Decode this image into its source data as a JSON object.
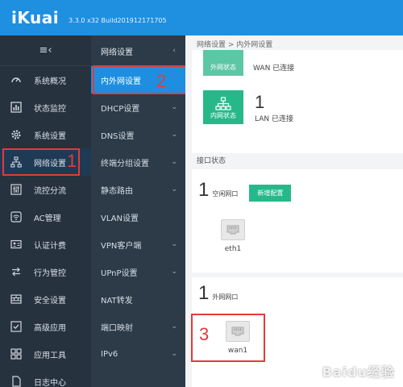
{
  "header": {
    "logo": "iKuai",
    "version": "3.3.0 x32 Build201912171705"
  },
  "sidebar": {
    "collapse_icon": "≡‹",
    "items": [
      {
        "label": "系统概况",
        "icon": "gauge-icon"
      },
      {
        "label": "状态监控",
        "icon": "chart-icon"
      },
      {
        "label": "系统设置",
        "icon": "gear-icon"
      },
      {
        "label": "网络设置",
        "icon": "network-icon",
        "active": true
      },
      {
        "label": "流控分流",
        "icon": "sliders-icon"
      },
      {
        "label": "AC管理",
        "icon": "wifi-icon"
      },
      {
        "label": "认证计费",
        "icon": "id-card-icon"
      },
      {
        "label": "行为管控",
        "icon": "arrows-icon"
      },
      {
        "label": "安全设置",
        "icon": "shield-icon"
      },
      {
        "label": "高级应用",
        "icon": "check-icon"
      },
      {
        "label": "应用工具",
        "icon": "grid-icon"
      },
      {
        "label": "日志中心",
        "icon": "doc-icon"
      }
    ]
  },
  "submenu": {
    "title": "网络设置",
    "items": [
      {
        "label": "内外网设置",
        "active": true,
        "chevron": false
      },
      {
        "label": "DHCP设置",
        "chevron": true
      },
      {
        "label": "DNS设置",
        "chevron": true
      },
      {
        "label": "终端分组设置",
        "chevron": true
      },
      {
        "label": "静态路由",
        "chevron": true
      },
      {
        "label": "VLAN设置",
        "chevron": false
      },
      {
        "label": "VPN客户端",
        "chevron": true
      },
      {
        "label": "UPnP设置",
        "chevron": true
      },
      {
        "label": "NAT转发",
        "chevron": false
      },
      {
        "label": "端口映射",
        "chevron": true
      },
      {
        "label": "IPv6",
        "chevron": true
      }
    ]
  },
  "main": {
    "breadcrumb": "网络设置 > 内外网设置",
    "wan_status": {
      "tile_label": "外网状态",
      "text": "WAN 已连接"
    },
    "lan_status": {
      "tile_label": "内网状态",
      "count": "1",
      "text": "LAN 已连接"
    },
    "interface_status_label": "接口状态",
    "idle": {
      "count": "1",
      "label": "空闲网口",
      "add_button": "新增配置",
      "port": "eth1"
    },
    "wan": {
      "count": "1",
      "label": "外网网口",
      "port": "wan1"
    }
  },
  "annotations": {
    "step1": "1",
    "step2": "2",
    "step3": "3"
  },
  "watermark": "Baidu经验"
}
